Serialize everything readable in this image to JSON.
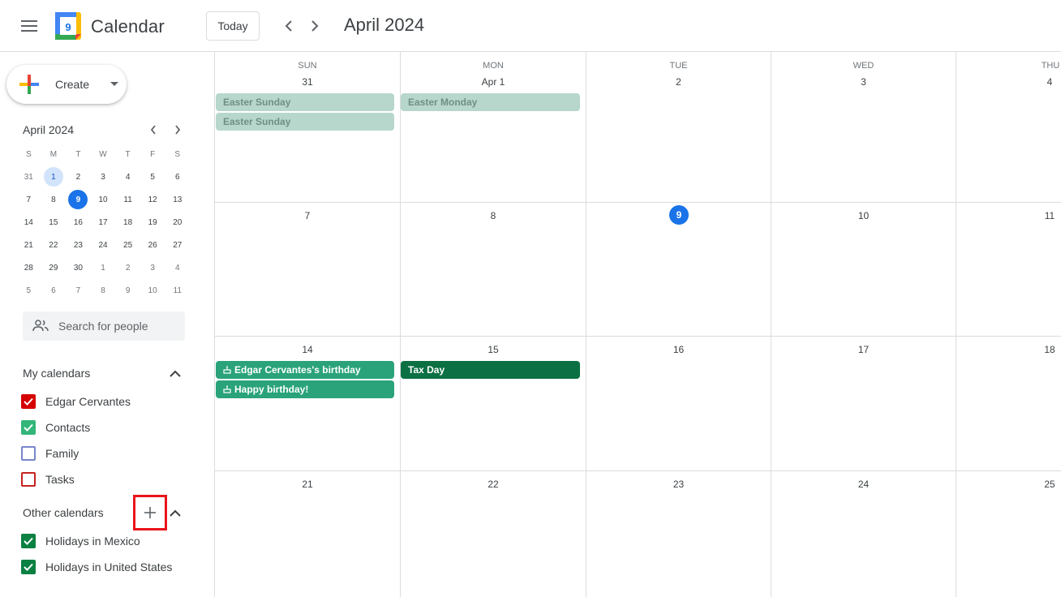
{
  "header": {
    "app_title": "Calendar",
    "logo_day": "9",
    "today_label": "Today",
    "month_title": "April 2024",
    "icons": [
      "menu-icon",
      "prev-icon",
      "next-icon"
    ]
  },
  "sidebar": {
    "create_label": "Create",
    "mini_calendar": {
      "title": "April 2024",
      "weekdays": [
        "S",
        "M",
        "T",
        "W",
        "T",
        "F",
        "S"
      ],
      "weeks": [
        [
          "31",
          "1",
          "2",
          "3",
          "4",
          "5",
          "6"
        ],
        [
          "7",
          "8",
          "9",
          "10",
          "11",
          "12",
          "13"
        ],
        [
          "14",
          "15",
          "16",
          "17",
          "18",
          "19",
          "20"
        ],
        [
          "21",
          "22",
          "23",
          "24",
          "25",
          "26",
          "27"
        ],
        [
          "28",
          "29",
          "30",
          "1",
          "2",
          "3",
          "4"
        ],
        [
          "5",
          "6",
          "7",
          "8",
          "9",
          "10",
          "11"
        ]
      ]
    },
    "search_placeholder": "Search for people",
    "my_calendars": {
      "title": "My calendars",
      "items": [
        {
          "label": "Edgar Cervantes",
          "color": "#d50000",
          "checked": true
        },
        {
          "label": "Contacts",
          "color": "#33b679",
          "checked": true
        },
        {
          "label": "Family",
          "color": "#7986cb",
          "checked": false
        },
        {
          "label": "Tasks",
          "color": "#c5221f",
          "checked": false
        }
      ]
    },
    "other_calendars": {
      "title": "Other calendars",
      "items": [
        {
          "label": "Holidays in Mexico",
          "color": "#0b8043",
          "checked": true
        },
        {
          "label": "Holidays in United States",
          "color": "#0b8043",
          "checked": true
        }
      ]
    }
  },
  "grid": {
    "weekdays": [
      "SUN",
      "MON",
      "TUE",
      "WED",
      "THU"
    ],
    "weeks": [
      [
        "31",
        "Apr 1",
        "2",
        "3",
        "4"
      ],
      [
        "7",
        "8",
        "9",
        "10",
        "11"
      ],
      [
        "14",
        "15",
        "16",
        "17",
        "18"
      ],
      [
        "21",
        "22",
        "23",
        "24",
        "25"
      ]
    ],
    "today": "9",
    "events": {
      "easter_sunday_1": "Easter Sunday",
      "easter_sunday_2": "Easter Sunday",
      "easter_monday": "Easter Monday",
      "birthday_edgar": "Edgar Cervantes's birthday",
      "happy_birthday": "Happy birthday!",
      "tax_day": "Tax Day"
    }
  }
}
